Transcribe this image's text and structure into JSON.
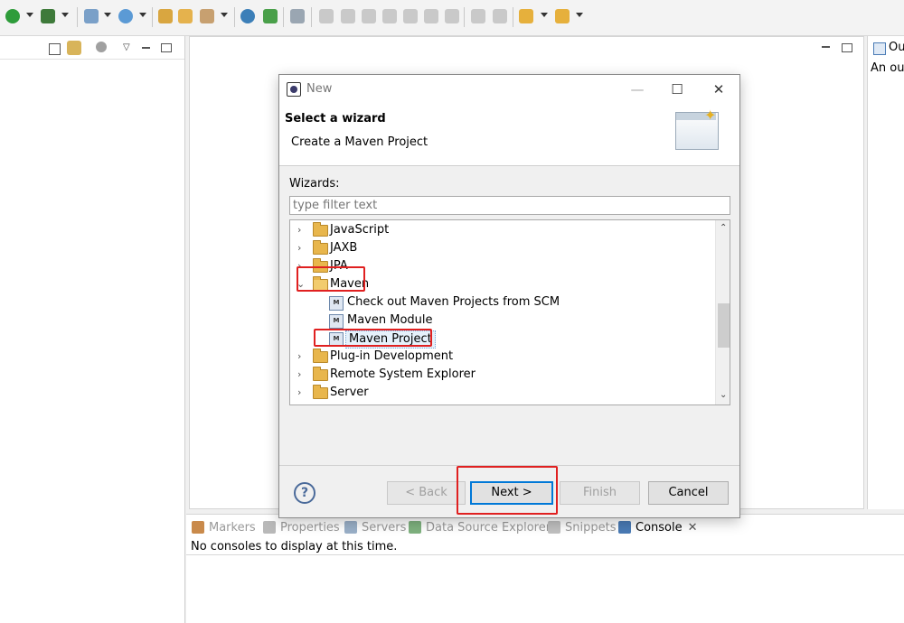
{
  "toolbar": {
    "icons": [
      "run-icon",
      "debug-icon",
      "new-project-icon",
      "new-class-icon",
      "open-type-icon",
      "open-folder-icon",
      "external-tools-icon",
      "web-browser-icon",
      "run-as-icon",
      "skip-breakpoints-icon",
      "resume-icon",
      "suspend-icon",
      "terminate-icon",
      "disconnect-icon",
      "step-into-icon",
      "step-over-icon",
      "step-return-icon",
      "drop-to-frame-icon",
      "use-step-filters-icon",
      "back-icon",
      "forward-icon"
    ]
  },
  "outline": {
    "tab_label": "Ou",
    "message": "An out"
  },
  "dialog": {
    "title": "New",
    "banner_title": "Select a wizard",
    "banner_subtitle": "Create a Maven Project",
    "wizards_label": "Wizards:",
    "filter_placeholder": "type filter text",
    "tree": [
      {
        "label": "JavaScript",
        "type": "folder",
        "expanded": false
      },
      {
        "label": "JAXB",
        "type": "folder",
        "expanded": false
      },
      {
        "label": "JPA",
        "type": "folder",
        "expanded": false
      },
      {
        "label": "Maven",
        "type": "folder",
        "expanded": true
      },
      {
        "label": "Check out Maven Projects from SCM",
        "type": "item"
      },
      {
        "label": "Maven Module",
        "type": "item"
      },
      {
        "label": "Maven Project",
        "type": "item",
        "selected": true
      },
      {
        "label": "Plug-in Development",
        "type": "folder",
        "expanded": false
      },
      {
        "label": "Remote System Explorer",
        "type": "folder",
        "expanded": false
      },
      {
        "label": "Server",
        "type": "folder",
        "expanded": false
      }
    ],
    "buttons": {
      "help": "?",
      "back": "< Back",
      "next": "Next >",
      "finish": "Finish",
      "cancel": "Cancel"
    }
  },
  "console": {
    "tabs": [
      "Markers",
      "Properties",
      "Servers",
      "Data Source Explorer",
      "Snippets",
      "Console"
    ],
    "active_tab": "Console",
    "message": "No consoles to display at this time."
  },
  "colors": {
    "highlight_red": "#e02020",
    "selection": "#e5f1fb",
    "folder": "#e8b64c",
    "accent": "#0078d7"
  }
}
